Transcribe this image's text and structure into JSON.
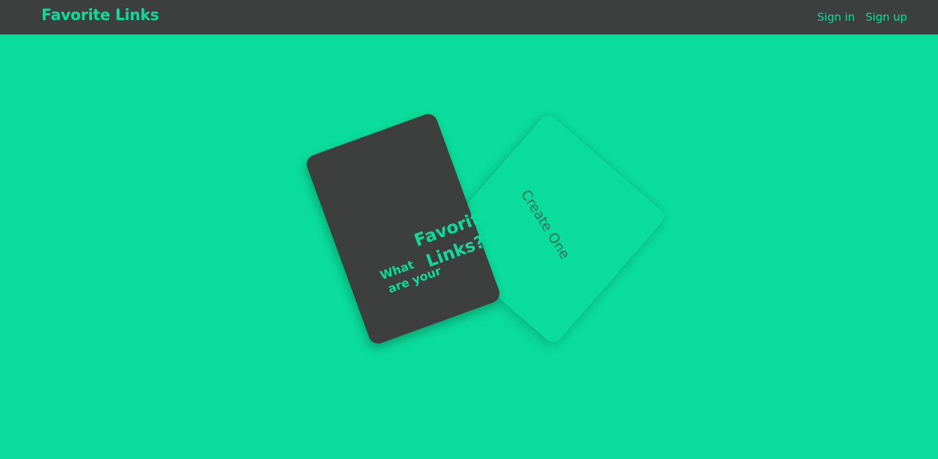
{
  "navbar": {
    "brand": "Favorite Links",
    "links": {
      "sign_in": "Sign in",
      "sign_up": "Sign up"
    }
  },
  "hero": {
    "front_card": {
      "line_what": "What",
      "line_are_your": "are your",
      "line_favorite": "Favorite",
      "line_links": "Links?"
    },
    "back_card": {
      "label": "Create One"
    }
  },
  "colors": {
    "accent": "#0adc9c",
    "navbar_bg": "#3d3f3f",
    "card_dark": "#3d3f3f",
    "back_card_text": "#2c6e58"
  }
}
